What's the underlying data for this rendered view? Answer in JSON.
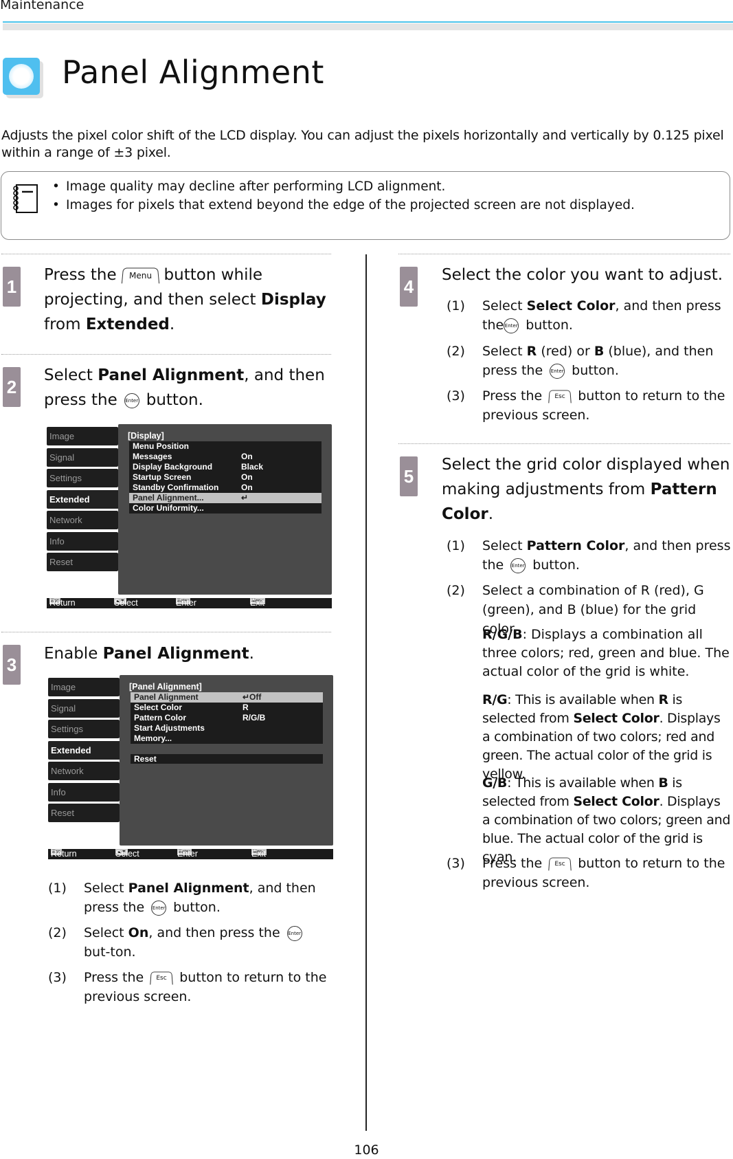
{
  "header": {
    "section": "Maintenance"
  },
  "title": "Panel Alignment",
  "intro": "Adjusts the pixel color shift of the LCD display. You can adjust the pixels horizontally and vertically by 0.125 pixel within a range of ±3 pixel.",
  "note": {
    "icon": "note-pad-icon",
    "items": [
      "Image quality may decline after performing LCD alignment.",
      "Images for pixels that extend beyond the edge of the projected screen are not displayed."
    ]
  },
  "keys": {
    "menu": "Menu",
    "enter": "Enter",
    "esc": "Esc"
  },
  "steps": {
    "s1": {
      "num": "1",
      "a": "Press the",
      "b": "button while projecting, and then select",
      "c": "Display",
      "d": "from",
      "e": "Extended",
      "f": "."
    },
    "s2": {
      "num": "2",
      "a": "Select",
      "b": "Panel Alignment",
      "c": ", and then press the",
      "d": "button."
    },
    "s3": {
      "num": "3",
      "a": "Enable",
      "b": "Panel Alignment",
      "c": ".",
      "subs": [
        {
          "n": "(1)",
          "a": "Select",
          "b": "Panel Alignment",
          "c": ", and then press the",
          "d": "button."
        },
        {
          "n": "(2)",
          "a": "Select",
          "b": "On",
          "c": ", and then press the",
          "d": "but-ton."
        },
        {
          "n": "(3)",
          "a": "Press the",
          "d": "button to return to the previous screen."
        }
      ]
    },
    "s4": {
      "num": "4",
      "a": "Select the color you want to adjust.",
      "subs": [
        {
          "n": "(1)",
          "a": "Select",
          "b": "Select Color",
          "c": ", and then press the",
          "d": "button."
        },
        {
          "n": "(2)",
          "a": "Select",
          "b": "R",
          "c": "(red) or",
          "e": "B",
          "f": "(blue), and then press the",
          "d": "button."
        },
        {
          "n": "(3)",
          "a": "Press the",
          "d": "button to return to the previous screen."
        }
      ]
    },
    "s5": {
      "num": "5",
      "a": "Select the grid color displayed when making adjustments from",
      "b": "Pattern Color",
      "c": ".",
      "subs": [
        {
          "n": "(1)",
          "a": "Select",
          "b": "Pattern Color",
          "c": ", and then press the",
          "d": "button."
        },
        {
          "n": "(2)",
          "a": "Select a combination of R (red), G (green), and B (blue) for the grid color."
        },
        {
          "n": "(3)",
          "a": "Press the",
          "d": "button to return to the previous screen."
        }
      ],
      "options": [
        {
          "k": "R/G/B",
          "t": ": Displays a combination all three colors; red, green and blue. The actual color of the grid is white."
        },
        {
          "k": "R/G",
          "t1": ": This is available when",
          "k2": "R",
          "t2": "is selected from",
          "k3": "Select Color",
          "t3": ". Displays a combination of two colors; red and green. The actual color of the grid is yellow."
        },
        {
          "k": "G/B",
          "t1": ": This is available when",
          "k2": "B",
          "t2": "is selected from",
          "k3": "Select Color",
          "t3": ". Displays a combination of two colors; green and blue. The actual color of the grid is cyan."
        }
      ]
    }
  },
  "osd1": {
    "tabs": [
      "Image",
      "Signal",
      "Settings",
      "Extended",
      "Network",
      "Info",
      "Reset"
    ],
    "active_tab": "Extended",
    "panel_title": "[Display]",
    "rows": [
      {
        "label": "Menu Position",
        "value": ""
      },
      {
        "label": "Messages",
        "value": "On"
      },
      {
        "label": "Display Background",
        "value": "Black"
      },
      {
        "label": "Startup Screen",
        "value": "On"
      },
      {
        "label": "Standby Confirmation",
        "value": "On"
      },
      {
        "label": "Panel Alignment...",
        "value": "↵",
        "highlighted": true
      },
      {
        "label": "Color Uniformity...",
        "value": ""
      }
    ],
    "footer": [
      {
        "key": "Esc",
        "label": "Return"
      },
      {
        "key": "▲▼",
        "label": "Select"
      },
      {
        "key": "Enter",
        "label": "Enter"
      },
      {
        "key": "Menu",
        "label": "Exit"
      }
    ]
  },
  "osd2": {
    "tabs": [
      "Image",
      "Signal",
      "Settings",
      "Extended",
      "Network",
      "Info",
      "Reset"
    ],
    "active_tab": "Extended",
    "panel_title": "[Panel Alignment]",
    "rows": [
      {
        "label": "Panel Alignment",
        "value": "↵Off",
        "highlighted": true
      },
      {
        "label": "Select Color",
        "value": "R"
      },
      {
        "label": "Pattern Color",
        "value": "R/G/B"
      },
      {
        "label": "Start Adjustments",
        "value": ""
      },
      {
        "label": "Memory...",
        "value": ""
      },
      {
        "label": "",
        "value": "",
        "gap": true
      },
      {
        "label": "Reset",
        "value": ""
      }
    ],
    "footer": [
      {
        "key": "Esc",
        "label": "Return"
      },
      {
        "key": "▲▼",
        "label": "Select"
      },
      {
        "key": "Enter",
        "label": "Enter"
      },
      {
        "key": "Menu",
        "label": "Exit"
      }
    ]
  },
  "footer": {
    "page_number": "106"
  },
  "colors": {
    "accent_rule": "#4cc3ea",
    "step_badge": "#9a8f98",
    "title_icon": "#4fbfef"
  }
}
